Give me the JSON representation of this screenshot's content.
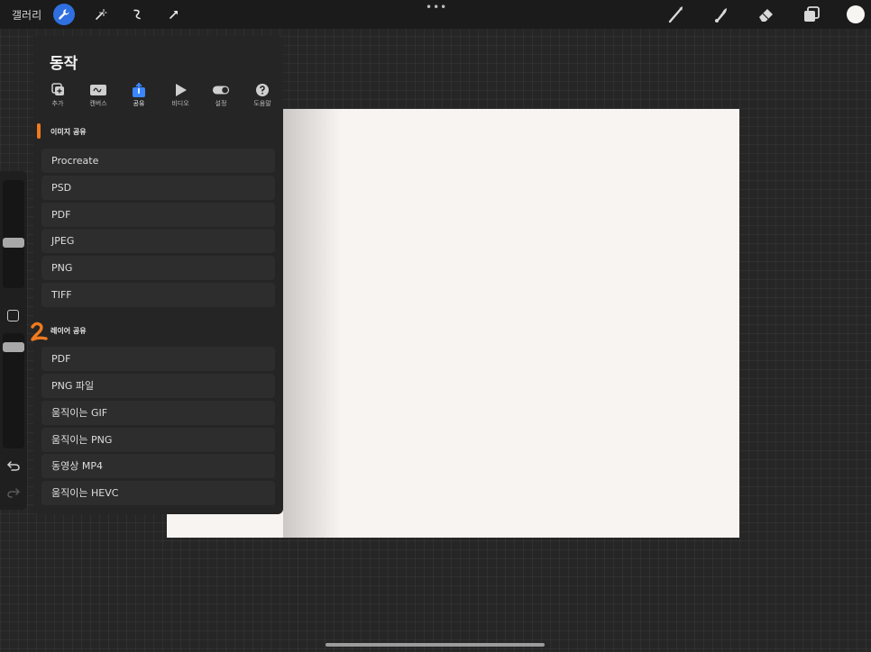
{
  "topbar": {
    "gallery_label": "갤러리",
    "tools": [
      {
        "name": "wrench-icon",
        "active": true
      },
      {
        "name": "magic-wand-icon",
        "active": false
      },
      {
        "name": "selection-icon",
        "active": false
      },
      {
        "name": "transform-arrow-icon",
        "active": false
      }
    ],
    "more_label": "•••",
    "right_tools": [
      "brush-icon",
      "smudge-icon",
      "eraser-icon",
      "layers-icon"
    ],
    "current_color": "#f7f5f2"
  },
  "panel": {
    "title": "동작",
    "tabs": [
      {
        "label": "추가",
        "icon": "add-icon"
      },
      {
        "label": "캔버스",
        "icon": "canvas-icon"
      },
      {
        "label": "공유",
        "icon": "share-icon",
        "active": true
      },
      {
        "label": "비디오",
        "icon": "video-icon"
      },
      {
        "label": "설정",
        "icon": "toggle-icon"
      },
      {
        "label": "도움말",
        "icon": "help-icon"
      }
    ],
    "image_share": {
      "header": "이미지 공유",
      "items": [
        "Procreate",
        "PSD",
        "PDF",
        "JPEG",
        "PNG",
        "TIFF"
      ]
    },
    "layer_share": {
      "header": "레이어 공유",
      "items": [
        "PDF",
        "PNG 파일",
        "움직이는 GIF",
        "움직이는 PNG",
        "동영상 MP4",
        "움직이는 HEVC"
      ]
    }
  },
  "colors": {
    "accent": "#2f6fe0",
    "annotation": "#f07a1e",
    "canvas": "#f8f4f1"
  }
}
